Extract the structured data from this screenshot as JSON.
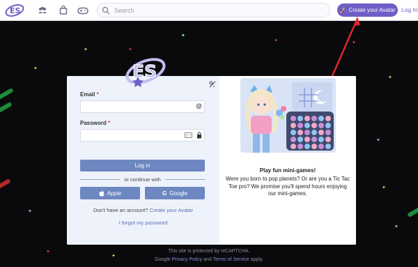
{
  "topbar": {
    "search_placeholder": "Search",
    "create_avatar_label": "Create your Avatar",
    "login_label": "Log In",
    "accent_color": "#6e5fc7"
  },
  "login_card": {
    "email_label": "Email",
    "password_label": "Password",
    "email_value": "",
    "password_value": "",
    "required_mark": "*",
    "email_suffix_icon": "at-sign-icon",
    "password_suffix_icons": [
      "keyboard-icon",
      "lock-icon"
    ],
    "login_button": "Log in",
    "or_continue_with": "or continue with",
    "apple_button": "Apple",
    "google_button": "Google",
    "no_account_text": "Don't have an account?",
    "create_avatar_link": "Create your Avatar",
    "forgot_password": "I forgot my password",
    "button_color": "#6d87c0"
  },
  "promo": {
    "title": "Play fun mini-games!",
    "text": "Were you born to pop planets? Or are you a Tic Tac Toe pro? We promise you'll spend hours enjoying our mini-games."
  },
  "footer": {
    "line1": "This site is protected by reCAPTCHA.",
    "line2_prefix": "Google",
    "privacy_policy": "Privacy Policy",
    "and": "and",
    "terms_of_service": "Terms of Service",
    "apply": "apply."
  }
}
